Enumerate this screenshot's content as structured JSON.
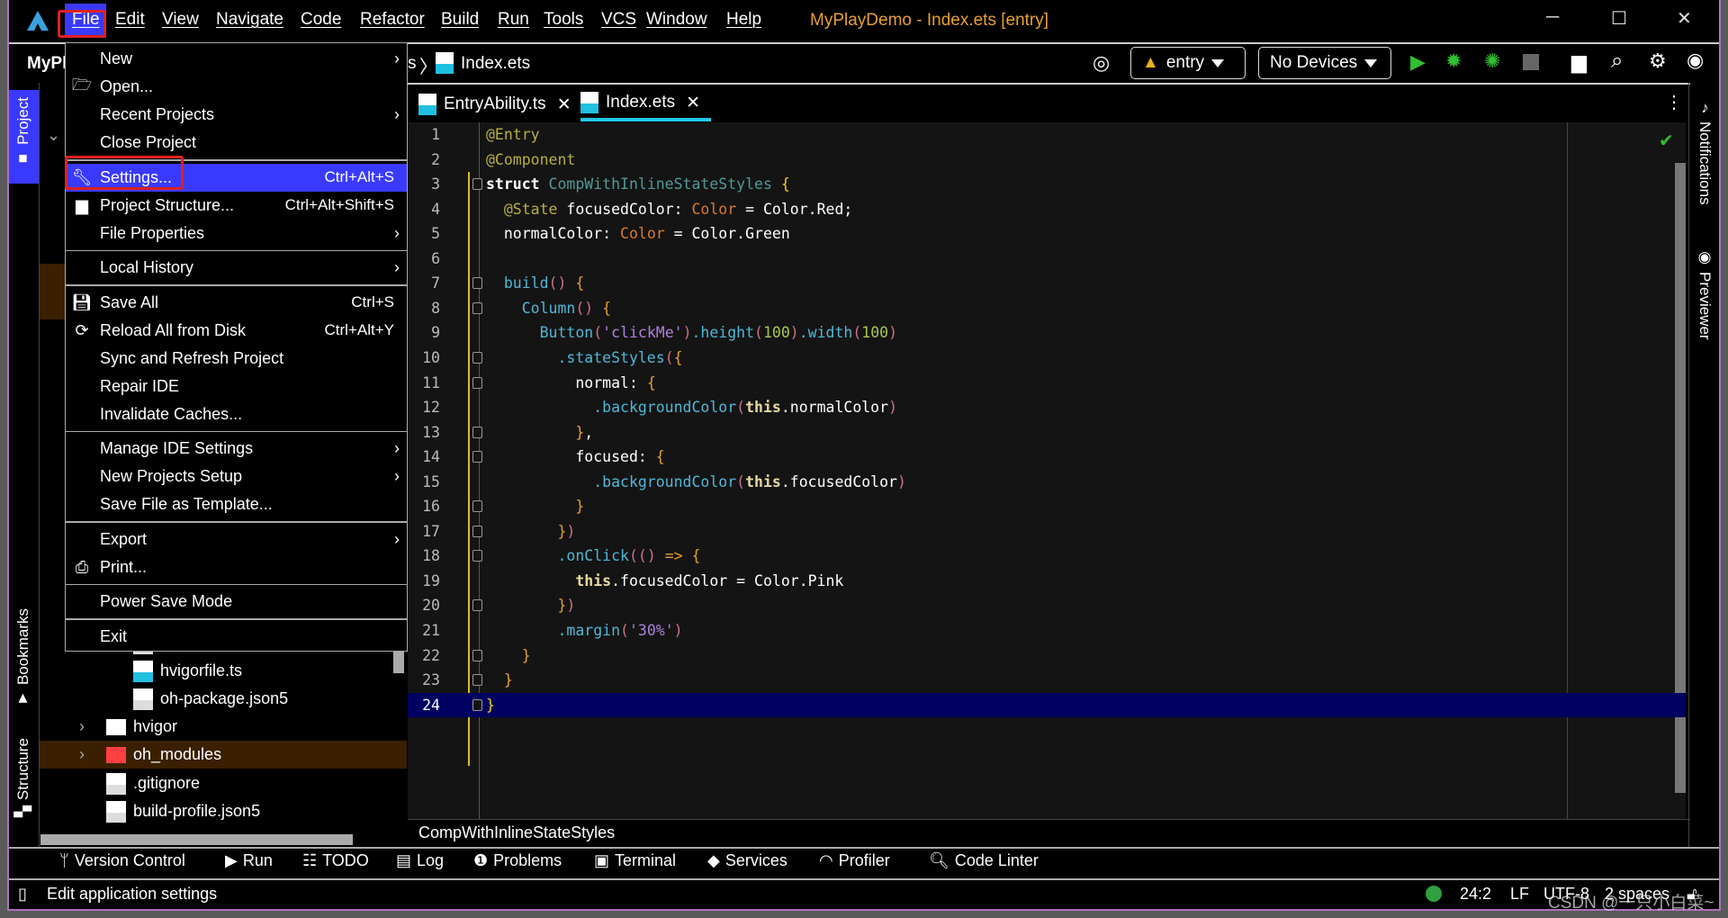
{
  "title_bar": {
    "menus": [
      "File",
      "Edit",
      "View",
      "Navigate",
      "Code",
      "Refactor",
      "Build",
      "Run",
      "Tools",
      "VCS",
      "Window",
      "Help"
    ],
    "window_title": "MyPlayDemo - Index.ets [entry]"
  },
  "toolbar": {
    "project_label": "MyPl",
    "breadcrumb_prefix": "s",
    "breadcrumb_file": "Index.ets",
    "module_selector": "entry",
    "device_selector": "No Devices"
  },
  "tabs": [
    {
      "label": "EntryAbility.ts",
      "icon": "ts-file-icon",
      "active": false
    },
    {
      "label": "Index.ets",
      "icon": "ets-file-icon",
      "active": true
    }
  ],
  "left_stripe": {
    "project": "Project",
    "bookmarks": "Bookmarks",
    "structure": "Structure"
  },
  "right_stripe": {
    "notifications": "Notifications",
    "previewer": "Previewer"
  },
  "file_menu": [
    [
      {
        "label": "New",
        "submenu": true
      },
      {
        "label": "Open...",
        "icon": "open-folder-icon"
      },
      {
        "label": "Recent Projects",
        "submenu": true
      },
      {
        "label": "Close Project"
      }
    ],
    [
      {
        "label": "Settings...",
        "shortcut": "Ctrl+Alt+S",
        "icon": "wrench-icon",
        "highlighted": true
      },
      {
        "label": "Project Structure...",
        "shortcut": "Ctrl+Alt+Shift+S",
        "icon": "project-structure-icon"
      },
      {
        "label": "File Properties",
        "submenu": true
      }
    ],
    [
      {
        "label": "Local History",
        "submenu": true
      }
    ],
    [
      {
        "label": "Save All",
        "shortcut": "Ctrl+S",
        "icon": "save-icon"
      },
      {
        "label": "Reload All from Disk",
        "shortcut": "Ctrl+Alt+Y",
        "icon": "reload-icon"
      },
      {
        "label": "Sync and Refresh Project"
      },
      {
        "label": "Repair IDE"
      },
      {
        "label": "Invalidate Caches..."
      }
    ],
    [
      {
        "label": "Manage IDE Settings",
        "submenu": true
      },
      {
        "label": "New Projects Setup",
        "submenu": true
      },
      {
        "label": "Save File as Template..."
      }
    ],
    [
      {
        "label": "Export",
        "submenu": true
      },
      {
        "label": "Print...",
        "icon": "print-icon"
      }
    ],
    [
      {
        "label": "Power Save Mode"
      }
    ],
    [
      {
        "label": "Exit"
      }
    ]
  ],
  "project_tree": [
    {
      "label": "build-profile.json5",
      "indent": 3,
      "icon": "json-config-icon"
    },
    {
      "label": "hvigorfile.ts",
      "indent": 3,
      "icon": "ts-file-icon"
    },
    {
      "label": "oh-package.json5",
      "indent": 3,
      "icon": "json-config-icon"
    },
    {
      "label": "hvigor",
      "indent": 2,
      "icon": "folder-icon",
      "expandable": true
    },
    {
      "label": "oh_modules",
      "indent": 2,
      "icon": "red-folder-icon",
      "expandable": true,
      "highlighted": true
    },
    {
      "label": ".gitignore",
      "indent": 2,
      "icon": "ignore-file-icon"
    },
    {
      "label": "build-profile.json5",
      "indent": 2,
      "icon": "json-config-icon"
    }
  ],
  "editor": {
    "current_line": 24,
    "lines": [
      [
        [
          "t-ann",
          "@Entry"
        ]
      ],
      [
        [
          "t-ann",
          "@Component"
        ]
      ],
      [
        [
          "t-kw",
          "struct "
        ],
        [
          "t-cls",
          "CompWithInlineStateStyles "
        ],
        [
          "t-br",
          "{"
        ]
      ],
      [
        [
          "t-id",
          "  "
        ],
        [
          "t-ann",
          "@State "
        ],
        [
          "t-id",
          "focusedColor: "
        ],
        [
          "t-typ",
          "Color"
        ],
        [
          "t-id",
          " = Color.Red;"
        ]
      ],
      [
        [
          "t-id",
          "  normalColor: "
        ],
        [
          "t-typ",
          "Color"
        ],
        [
          "t-id",
          " = Color.Green"
        ]
      ],
      [],
      [
        [
          "t-fn",
          "  build"
        ],
        [
          "t-p",
          "()"
        ],
        [
          "t-br2",
          " {"
        ]
      ],
      [
        [
          "t-fn",
          "    Column"
        ],
        [
          "t-p",
          "()"
        ],
        [
          "t-br2",
          " {"
        ]
      ],
      [
        [
          "t-fn",
          "      Button"
        ],
        [
          "t-p",
          "("
        ],
        [
          "t-str",
          "'clickMe'"
        ],
        [
          "t-p",
          ")"
        ],
        [
          "t-fn",
          ".height"
        ],
        [
          "t-p",
          "("
        ],
        [
          "t-num",
          "100"
        ],
        [
          "t-p",
          ")"
        ],
        [
          "t-fn",
          ".width"
        ],
        [
          "t-p",
          "("
        ],
        [
          "t-num",
          "100"
        ],
        [
          "t-p",
          ")"
        ]
      ],
      [
        [
          "t-fn",
          "        .stateStyles"
        ],
        [
          "t-p",
          "("
        ],
        [
          "t-br2",
          "{"
        ]
      ],
      [
        [
          "t-id",
          "          normal: "
        ],
        [
          "t-br2",
          "{"
        ]
      ],
      [
        [
          "t-fn",
          "            .backgroundColor"
        ],
        [
          "t-p",
          "("
        ],
        [
          "t-this",
          "this"
        ],
        [
          "t-id",
          ".normalColor"
        ],
        [
          "t-p",
          ")"
        ]
      ],
      [
        [
          "t-br2",
          "          }"
        ],
        [
          "t-id",
          ","
        ]
      ],
      [
        [
          "t-id",
          "          focused: "
        ],
        [
          "t-br2",
          "{"
        ]
      ],
      [
        [
          "t-fn",
          "            .backgroundColor"
        ],
        [
          "t-p",
          "("
        ],
        [
          "t-this",
          "this"
        ],
        [
          "t-id",
          ".focusedColor"
        ],
        [
          "t-p",
          ")"
        ]
      ],
      [
        [
          "t-br2",
          "          }"
        ]
      ],
      [
        [
          "t-br2",
          "        }"
        ],
        [
          "t-p",
          ")"
        ]
      ],
      [
        [
          "t-fn",
          "        .onClick"
        ],
        [
          "t-p",
          "(()"
        ],
        [
          "t-br2",
          " => {"
        ]
      ],
      [
        [
          "t-this",
          "          this"
        ],
        [
          "t-id",
          ".focusedColor = Color.Pink"
        ]
      ],
      [
        [
          "t-br2",
          "        }"
        ],
        [
          "t-p",
          ")"
        ]
      ],
      [
        [
          "t-fn",
          "        .margin"
        ],
        [
          "t-p",
          "("
        ],
        [
          "t-str",
          "'30%'"
        ],
        [
          "t-p",
          ")"
        ]
      ],
      [
        [
          "t-br2",
          "    }"
        ]
      ],
      [
        [
          "t-br2",
          "  }"
        ]
      ],
      [
        [
          "t-br",
          "}"
        ]
      ]
    ],
    "breadcrumb": "CompWithInlineStateStyles"
  },
  "tool_windows": [
    {
      "label": "Version Control",
      "icon": "version-control-icon"
    },
    {
      "label": "Run",
      "icon": "run-icon"
    },
    {
      "label": "TODO",
      "icon": "todo-icon"
    },
    {
      "label": "Log",
      "icon": "log-icon"
    },
    {
      "label": "Problems",
      "icon": "problems-icon"
    },
    {
      "label": "Terminal",
      "icon": "terminal-icon"
    },
    {
      "label": "Services",
      "icon": "services-icon"
    },
    {
      "label": "Profiler",
      "icon": "profiler-icon"
    },
    {
      "label": "Code Linter",
      "icon": "code-linter-icon"
    }
  ],
  "status_bar": {
    "message": "Edit application settings",
    "position": "24:2",
    "line_ending": "LF",
    "encoding": "UTF-8",
    "indent": "2 spaces",
    "watermark": "CSDN @一只小白菜~"
  },
  "colors": {
    "accent": "#3a3aff",
    "highlight_row": "#3a2000",
    "current_line": "#000060",
    "annotation_box": "#e02020"
  }
}
